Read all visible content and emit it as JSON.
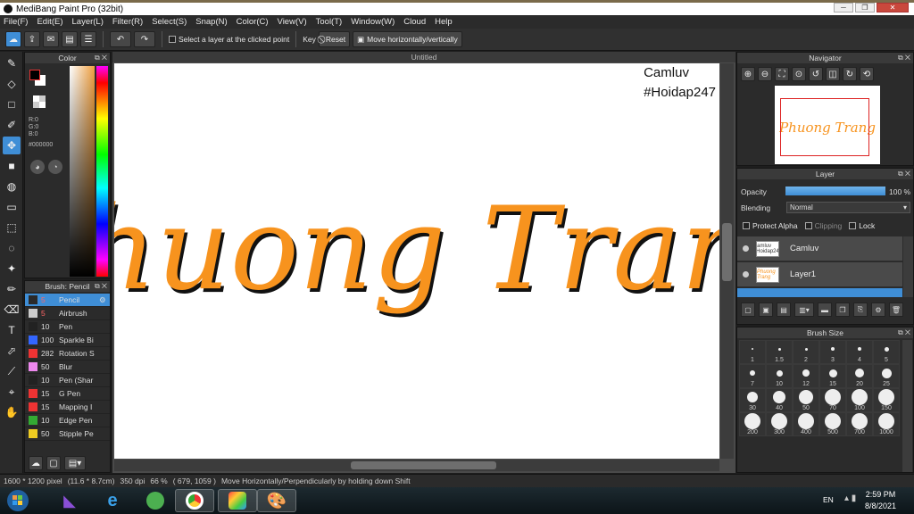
{
  "window": {
    "title": "MediBang Paint Pro (32bit)"
  },
  "menubar": [
    "File(F)",
    "Edit(E)",
    "Layer(L)",
    "Filter(R)",
    "Select(S)",
    "Snap(N)",
    "Color(C)",
    "View(V)",
    "Tool(T)",
    "Window(W)",
    "Cloud",
    "Help"
  ],
  "toolbar": {
    "select_layer_label": "Select a layer at the clicked point",
    "key_label": "Key",
    "reset_label": "Reset",
    "move_label": "Move horizontally/vertically"
  },
  "color_panel": {
    "title": "Color",
    "r": "R:0",
    "g": "G:0",
    "b": "B:0",
    "hex": "#000000",
    "foreground": "#000000",
    "background": "#ffffff"
  },
  "brush_panel": {
    "title": "Brush: Pencil",
    "items": [
      {
        "size": "5",
        "name": "Pencil",
        "color": "#2a2a2a",
        "selected": true
      },
      {
        "size": "5",
        "name": "Airbrush",
        "color": "#cccccc",
        "selected": false
      },
      {
        "size": "10",
        "name": "Pen",
        "color": "#222222",
        "selected": false
      },
      {
        "size": "100",
        "name": "Sparkle Bi",
        "color": "#3366ff",
        "selected": false
      },
      {
        "size": "282",
        "name": "Rotation S",
        "color": "#ee3333",
        "selected": false
      },
      {
        "size": "50",
        "name": "Blur",
        "color": "#ee88ee",
        "selected": false
      },
      {
        "size": "10",
        "name": "Pen (Shar",
        "color": "#222222",
        "selected": false
      },
      {
        "size": "15",
        "name": "G Pen",
        "color": "#ee3333",
        "selected": false
      },
      {
        "size": "15",
        "name": "Mapping I",
        "color": "#ee3333",
        "selected": false
      },
      {
        "size": "10",
        "name": "Edge Pen",
        "color": "#33aa33",
        "selected": false
      },
      {
        "size": "50",
        "name": "Stipple Pe",
        "color": "#eecc22",
        "selected": false
      }
    ]
  },
  "canvas": {
    "tab_title": "Untitled",
    "watermark_line1": "Camluv",
    "watermark_line2": "#Hoidap247",
    "artwork_text": "Phuong Trang",
    "artwork_color": "#f7931e"
  },
  "navigator": {
    "title": "Navigator",
    "preview_text": "Phuong Trang"
  },
  "layer_panel": {
    "title": "Layer",
    "opacity_label": "Opacity",
    "opacity_value": "100 %",
    "opacity_fraction": 1.0,
    "blending_label": "Blending",
    "blending_value": "Normal",
    "protect_alpha": "Protect Alpha",
    "clipping": "Clipping",
    "lock": "Lock",
    "layers": [
      {
        "name": "Camluv",
        "thumb": "Camluv #Hoidap247"
      },
      {
        "name": "Layer1",
        "thumb": "Phuong Trang"
      }
    ]
  },
  "brush_size_panel": {
    "title": "Brush Size",
    "sizes": [
      "1",
      "1.5",
      "2",
      "3",
      "4",
      "5",
      "7",
      "10",
      "12",
      "15",
      "20",
      "25",
      "30",
      "40",
      "50",
      "70",
      "100",
      "150",
      "200",
      "300",
      "400",
      "500",
      "700",
      "1000"
    ]
  },
  "statusbar": {
    "dimensions": "1600 * 1200 pixel",
    "physical": "(11.6 * 8.7cm)",
    "dpi": "350 dpi",
    "zoom": "66 %",
    "coords": "( 679, 1059 )",
    "hint": "Move Horizontally/Perpendicularly by holding down Shift"
  },
  "taskbar": {
    "lang": "EN",
    "time": "2:59 PM",
    "date": "8/8/2021"
  }
}
